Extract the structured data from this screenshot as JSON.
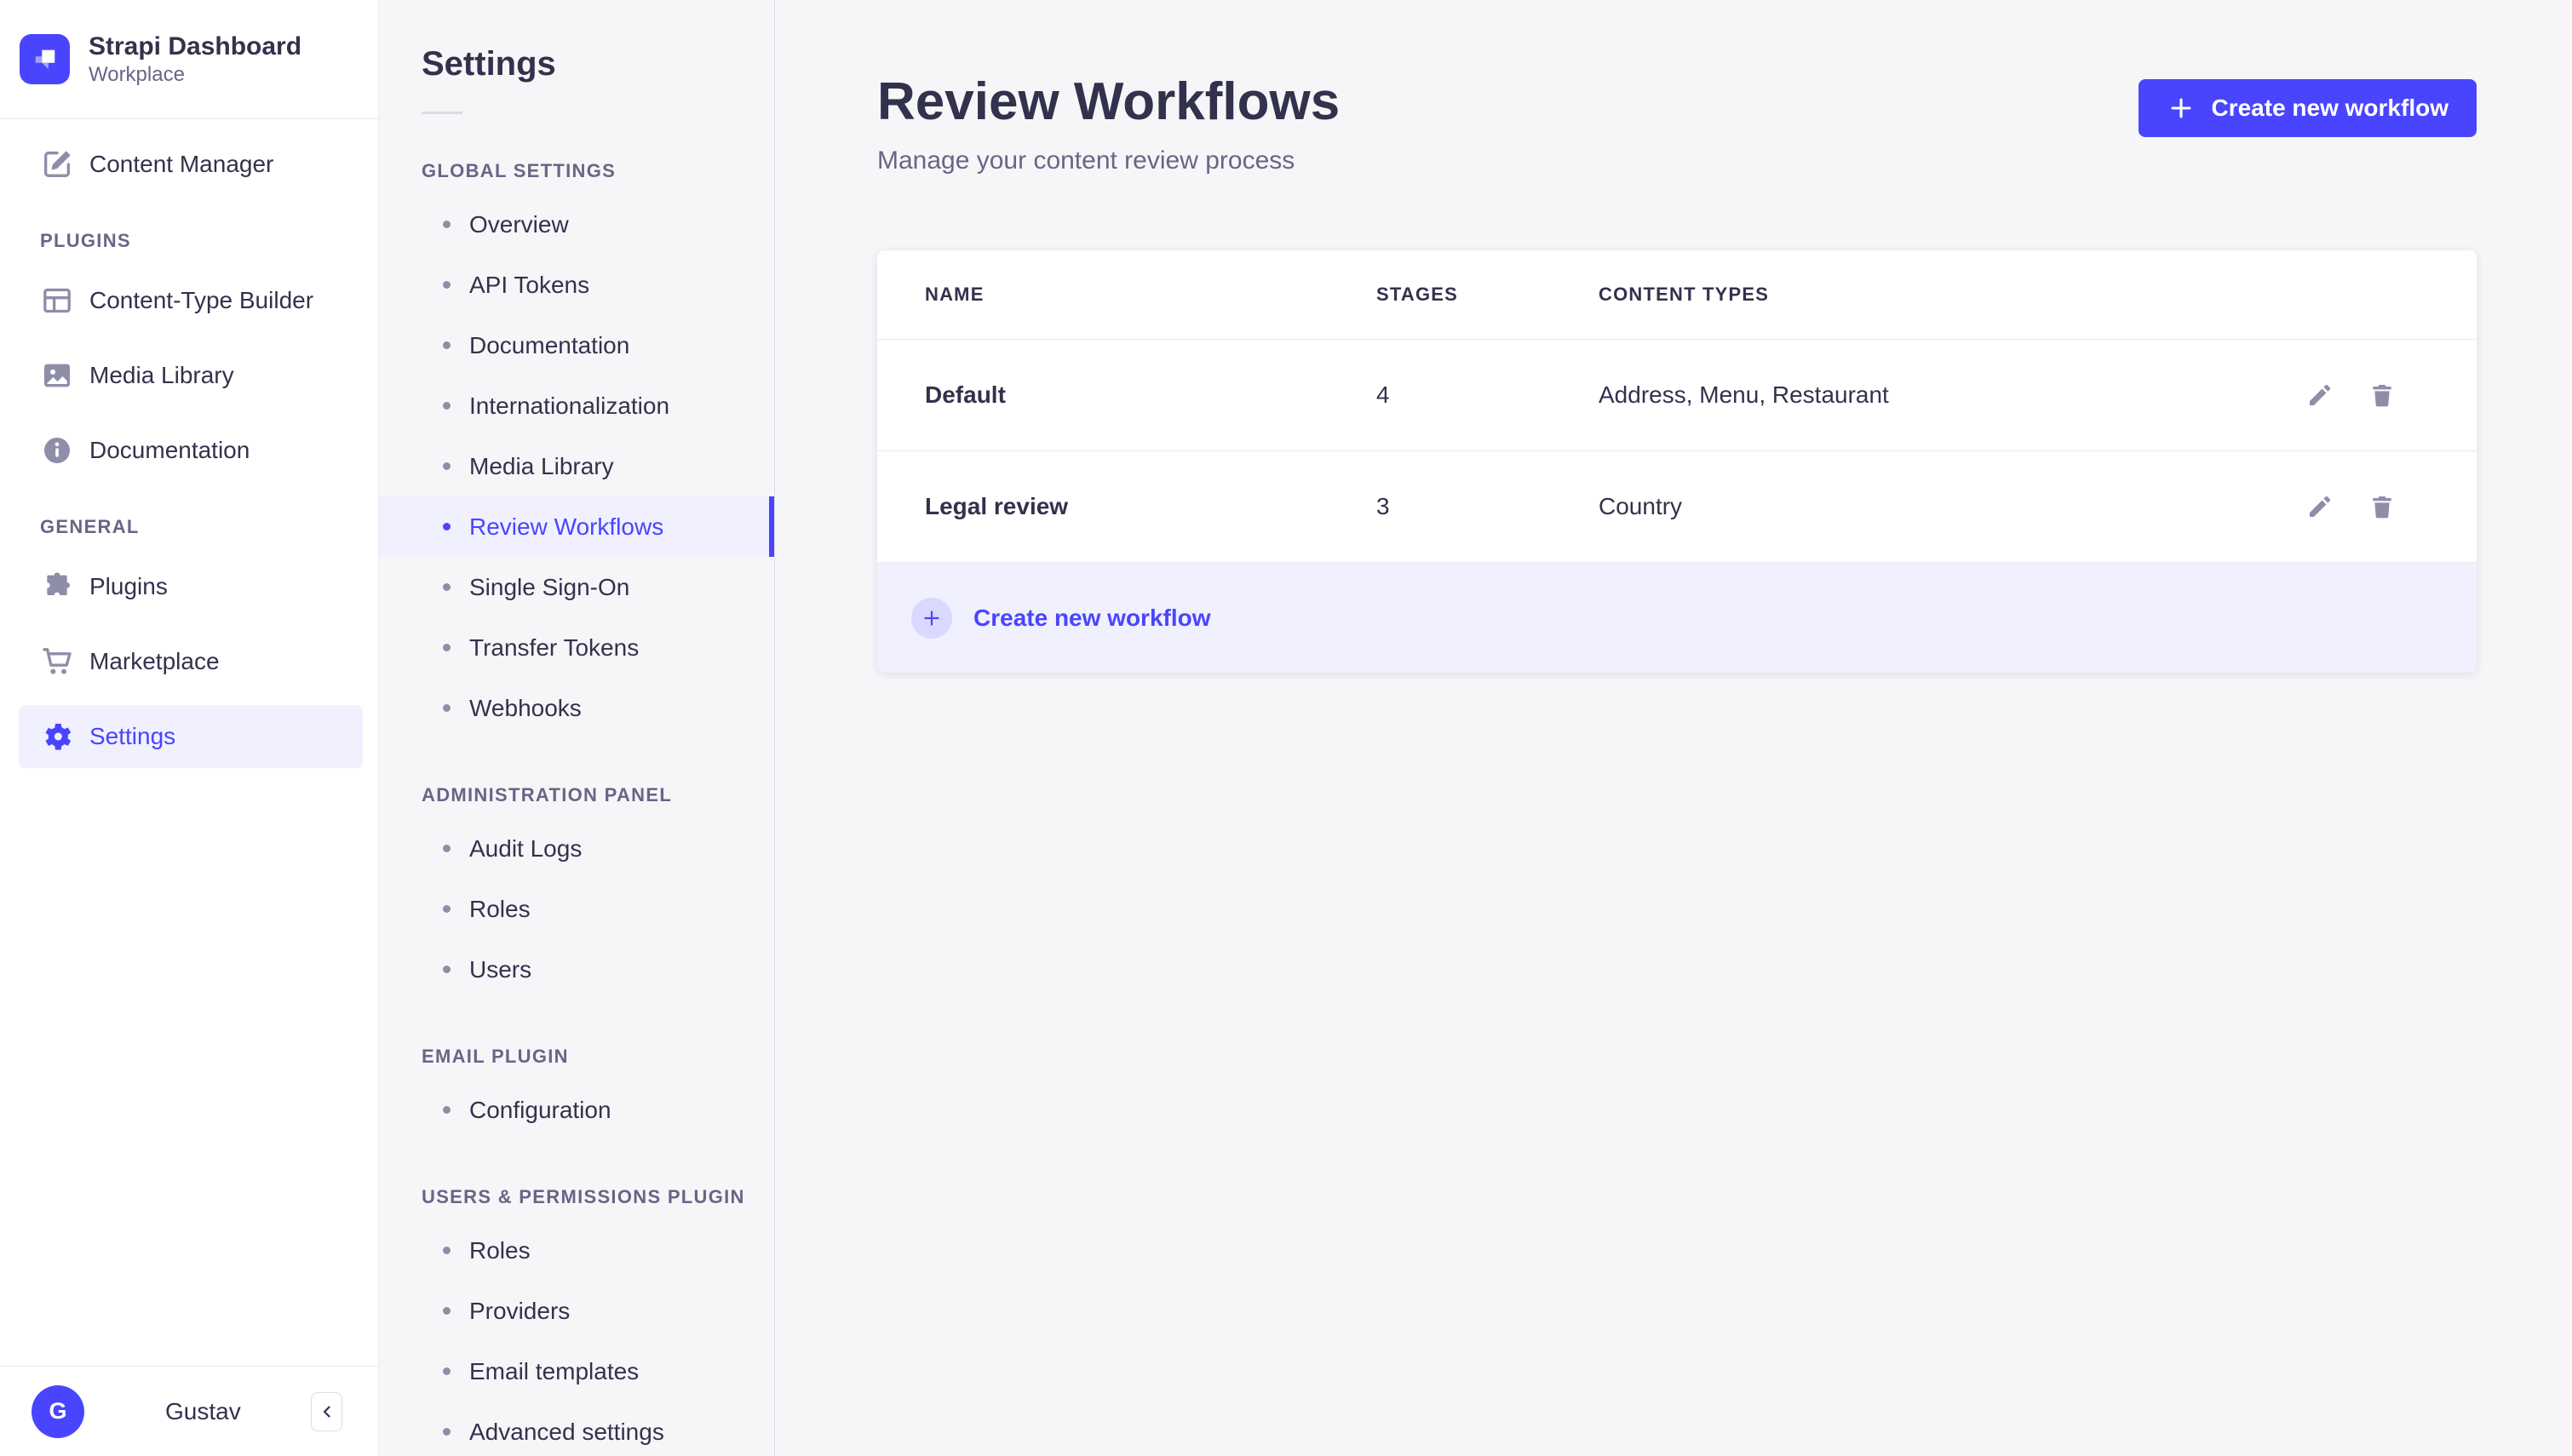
{
  "brand": {
    "name": "Strapi Dashboard",
    "workspace": "Workplace"
  },
  "colors": {
    "primary": "#4945FF",
    "primary_light": "#F0F0FF",
    "primary_pale": "#D9D8FF",
    "text_dark": "#32324D",
    "text_gray": "#666687",
    "icon_gray": "#8E8EA9",
    "background": "#F6F6F9",
    "border": "#EAEAEF"
  },
  "primary_nav": {
    "content_manager": {
      "label": "Content Manager"
    },
    "sections": [
      {
        "title": "PLUGINS",
        "items": [
          {
            "label": "Content-Type Builder",
            "icon": "layout-icon"
          },
          {
            "label": "Media Library",
            "icon": "image-icon"
          },
          {
            "label": "Documentation",
            "icon": "info-icon"
          }
        ]
      },
      {
        "title": "GENERAL",
        "items": [
          {
            "label": "Plugins",
            "icon": "puzzle-icon"
          },
          {
            "label": "Marketplace",
            "icon": "cart-icon"
          },
          {
            "label": "Settings",
            "icon": "gear-icon",
            "active": true
          }
        ]
      }
    ],
    "user": {
      "initial": "G",
      "name": "Gustav"
    }
  },
  "settings_nav": {
    "title": "Settings",
    "sections": [
      {
        "title": "GLOBAL SETTINGS",
        "items": [
          {
            "label": "Overview"
          },
          {
            "label": "API Tokens"
          },
          {
            "label": "Documentation"
          },
          {
            "label": "Internationalization"
          },
          {
            "label": "Media Library"
          },
          {
            "label": "Review Workflows",
            "active": true
          },
          {
            "label": "Single Sign-On"
          },
          {
            "label": "Transfer Tokens"
          },
          {
            "label": "Webhooks"
          }
        ]
      },
      {
        "title": "ADMINISTRATION PANEL",
        "items": [
          {
            "label": "Audit Logs"
          },
          {
            "label": "Roles"
          },
          {
            "label": "Users"
          }
        ]
      },
      {
        "title": "EMAIL PLUGIN",
        "items": [
          {
            "label": "Configuration"
          }
        ]
      },
      {
        "title": "USERS & PERMISSIONS PLUGIN",
        "items": [
          {
            "label": "Roles"
          },
          {
            "label": "Providers"
          },
          {
            "label": "Email templates"
          },
          {
            "label": "Advanced settings"
          }
        ]
      }
    ]
  },
  "main": {
    "page_title": "Review Workflows",
    "page_subtitle": "Manage your content review process",
    "create_button_label": "Create new workflow",
    "table": {
      "headers": {
        "name": "NAME",
        "stages": "STAGES",
        "content_types": "CONTENT TYPES"
      },
      "rows": [
        {
          "name": "Default",
          "stages": "4",
          "content_types": "Address, Menu, Restaurant"
        },
        {
          "name": "Legal review",
          "stages": "3",
          "content_types": "Country"
        }
      ]
    },
    "footer_create_label": "Create new workflow"
  }
}
